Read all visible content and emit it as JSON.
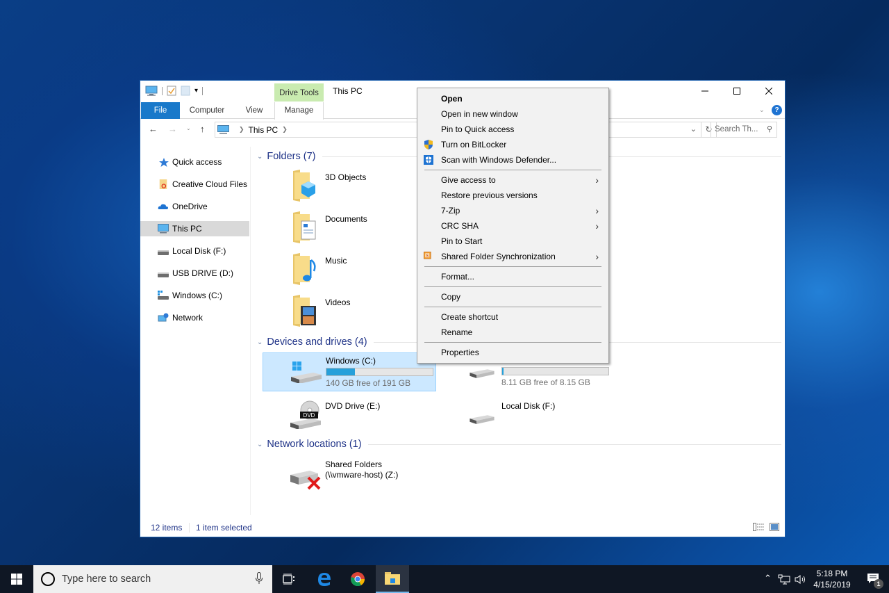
{
  "window": {
    "title": "This PC",
    "contextual_tab_group": "Drive Tools",
    "caption": {
      "minimize": "minimize",
      "maximize": "maximize",
      "close": "close"
    }
  },
  "ribbon": {
    "tabs": [
      {
        "label": "File"
      },
      {
        "label": "Computer"
      },
      {
        "label": "View"
      },
      {
        "label": "Manage"
      }
    ],
    "help": "?"
  },
  "navigation": {
    "breadcrumb": [
      "This PC"
    ],
    "search_placeholder": "Search Th..."
  },
  "sidebar": {
    "items": [
      {
        "label": "Quick access",
        "icon": "star-icon"
      },
      {
        "label": "Creative Cloud Files",
        "icon": "creative-cloud-folder-icon"
      },
      {
        "label": "OneDrive",
        "icon": "onedrive-cloud-icon"
      },
      {
        "label": "This PC",
        "icon": "computer-icon",
        "selected": true
      },
      {
        "label": "Local Disk (F:)",
        "icon": "drive-icon"
      },
      {
        "label": "USB DRIVE (D:)",
        "icon": "usb-drive-icon"
      },
      {
        "label": "Windows (C:)",
        "icon": "windows-drive-icon"
      },
      {
        "label": "Network",
        "icon": "network-icon"
      }
    ]
  },
  "content": {
    "folders_header": "Folders (7)",
    "folders": [
      {
        "name": "3D Objects",
        "icon": "3d-objects-folder-icon"
      },
      {
        "name": "Documents",
        "icon": "documents-folder-icon"
      },
      {
        "name": "Music",
        "icon": "music-folder-icon"
      },
      {
        "name": "Videos",
        "icon": "videos-folder-icon"
      }
    ],
    "devices_header": "Devices and drives (4)",
    "drives": [
      {
        "name": "Windows (C:)",
        "free_text": "140 GB free of 191 GB",
        "used_fraction": 0.27,
        "selected": true
      },
      {
        "name": "",
        "free_text": "8.11 GB free of 8.15 GB",
        "used_fraction": 0.005,
        "selected": false
      },
      {
        "name": "DVD Drive (E:)",
        "icon": "dvd-drive-icon",
        "badge": "DVD"
      },
      {
        "name": "Local Disk (F:)"
      }
    ],
    "network_header": "Network locations (1)",
    "network": [
      {
        "name_line1": "Shared Folders",
        "name_line2": "(\\\\vmware-host) (Z:)",
        "status": "disconnected"
      }
    ]
  },
  "status": {
    "item_count": "12 items",
    "selection": "1 item selected"
  },
  "context_menu": {
    "items": [
      {
        "label": "Open",
        "bold": true
      },
      {
        "label": "Open in new window"
      },
      {
        "label": "Pin to Quick access"
      },
      {
        "label": "Turn on BitLocker",
        "icon": "uac-shield-icon"
      },
      {
        "label": "Scan with Windows Defender...",
        "icon": "windows-defender-icon"
      },
      {
        "separator": true
      },
      {
        "label": "Give access to",
        "submenu": true
      },
      {
        "label": "Restore previous versions"
      },
      {
        "label": "7-Zip",
        "submenu": true
      },
      {
        "label": "CRC SHA",
        "submenu": true
      },
      {
        "label": "Pin to Start"
      },
      {
        "label": "Shared Folder Synchronization",
        "submenu": true,
        "icon": "sync-s-icon"
      },
      {
        "separator": true
      },
      {
        "label": "Format..."
      },
      {
        "separator": true
      },
      {
        "label": "Copy"
      },
      {
        "separator": true
      },
      {
        "label": "Create shortcut"
      },
      {
        "label": "Rename"
      },
      {
        "separator": true
      },
      {
        "label": "Properties"
      }
    ]
  },
  "taskbar": {
    "search_placeholder": "Type here to search",
    "apps": [
      "task-view",
      "edge",
      "chrome",
      "file-explorer"
    ],
    "clock_time": "5:18 PM",
    "clock_date": "4/15/2019",
    "notification_count": "1"
  },
  "colors": {
    "accent": "#1979ca",
    "context_tab": "#c9ebb0",
    "selection": "#cce8ff",
    "drive_bar": "#26a0da",
    "group_header": "#1e3287"
  }
}
